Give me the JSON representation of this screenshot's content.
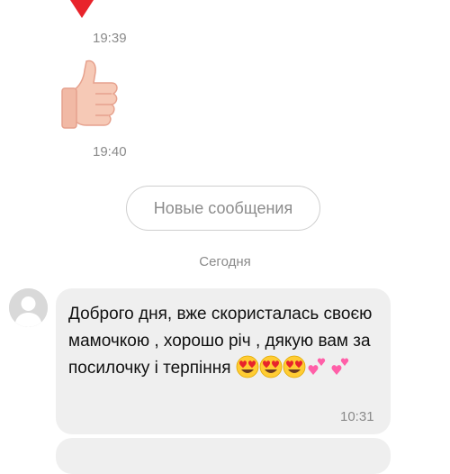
{
  "thread": {
    "time_1": "19:39",
    "time_2": "19:40",
    "new_messages_button": "Новые сообщения",
    "date_separator": "Сегодня"
  },
  "message": {
    "text_1": "Доброго дня, вже скористалась своєю мамочкою , хорошо річ , дякую вам за посилочку і терпіння",
    "emojis": [
      "heart-eyes-icon",
      "heart-eyes-icon",
      "heart-eyes-icon",
      "two-hearts-icon",
      "two-hearts-icon"
    ],
    "time": "10:31"
  },
  "colors": {
    "heart_red": "#e8232b",
    "bubble_bg": "#efefef",
    "meta_text": "#8a8a8a",
    "avatar_bg": "#d9d9d9"
  }
}
